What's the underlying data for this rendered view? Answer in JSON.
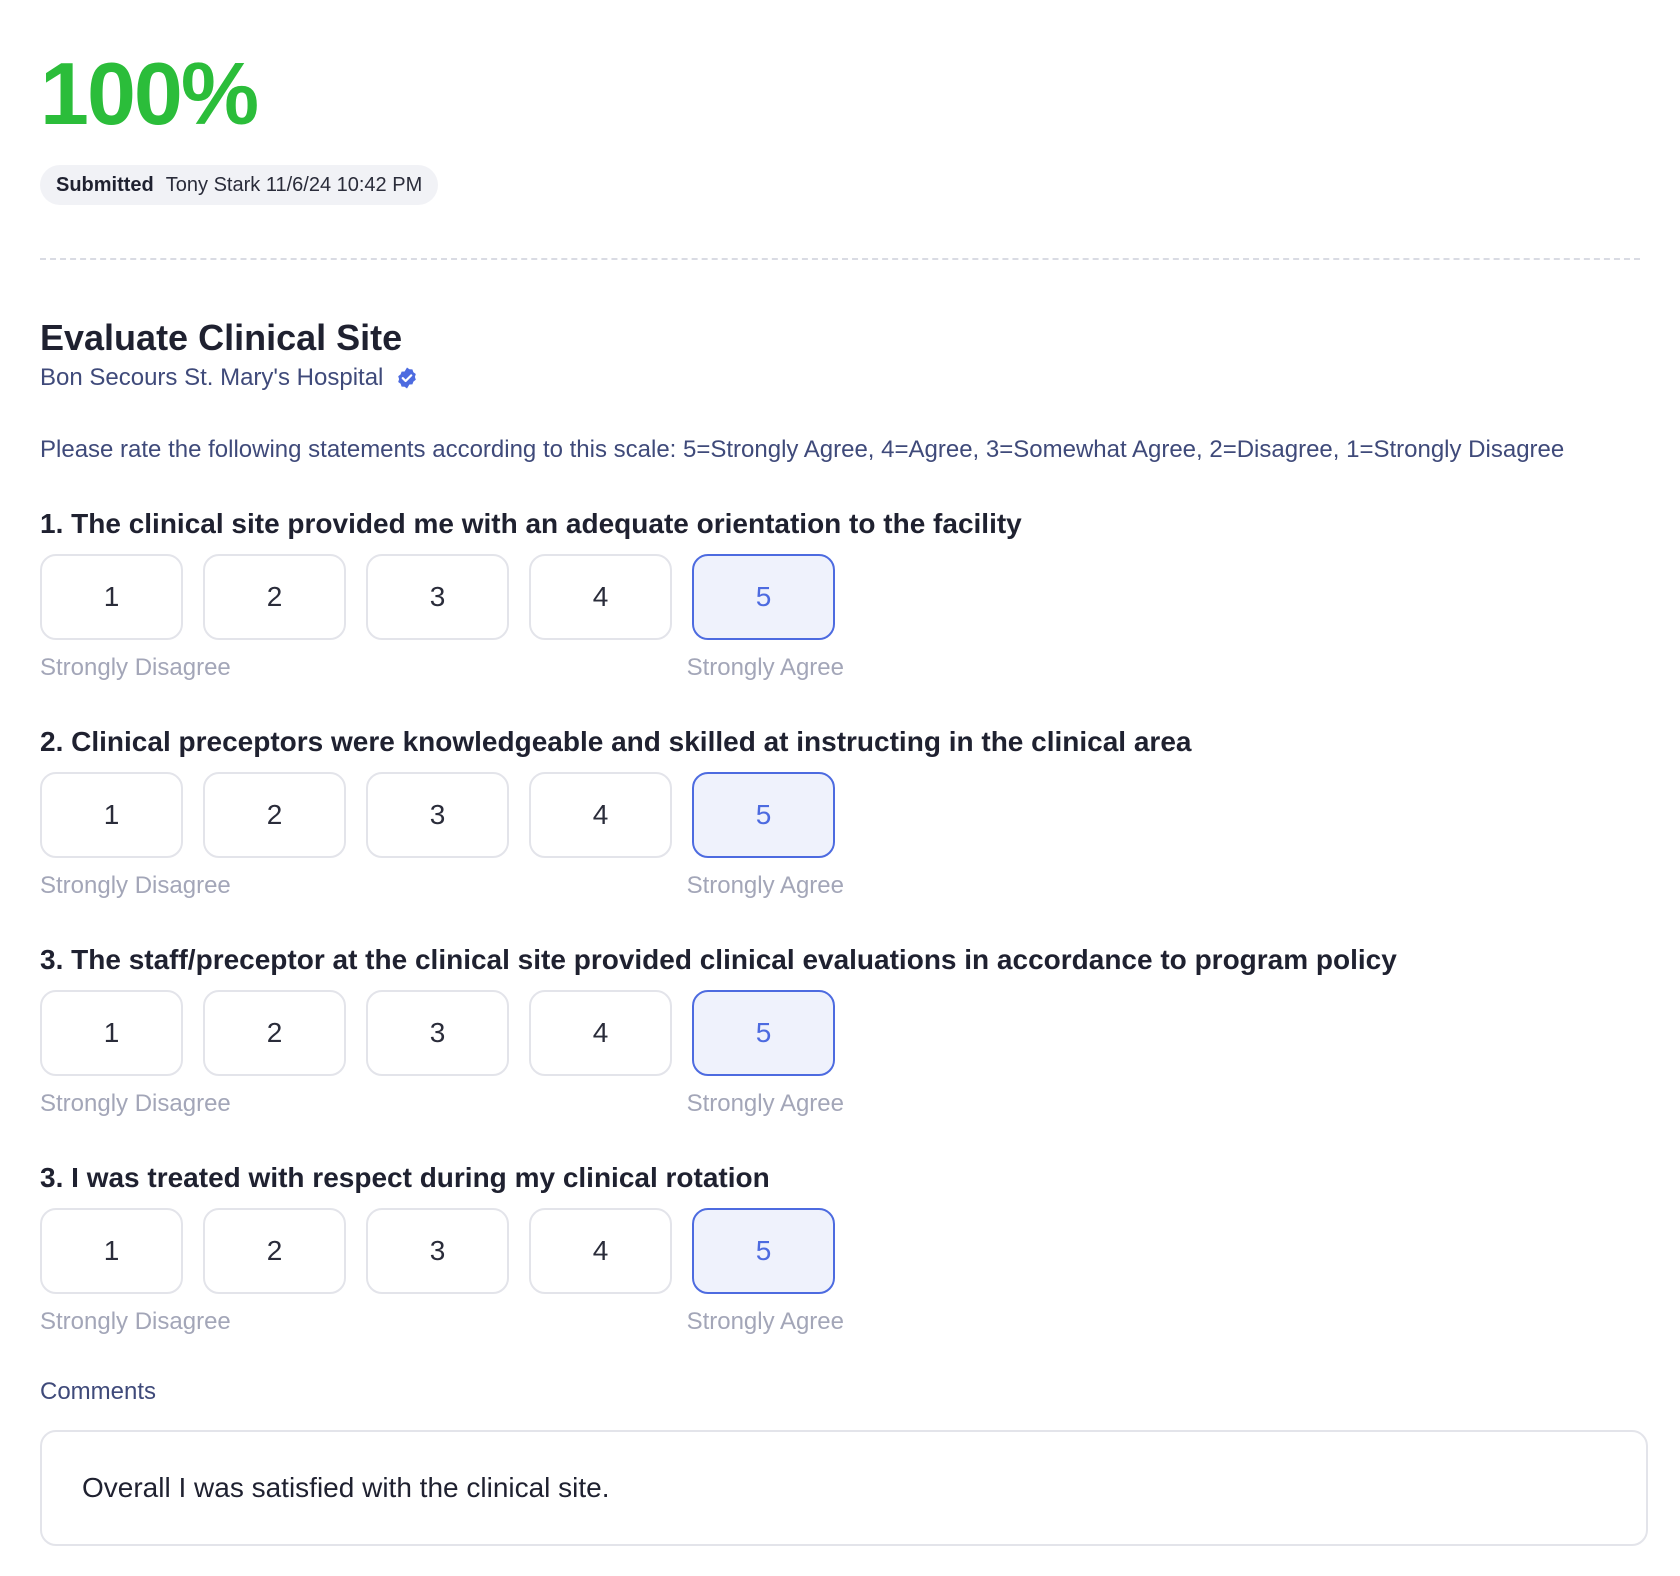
{
  "header": {
    "score": "100%",
    "status": "Submitted",
    "submitted_meta": "Tony Stark 11/6/24 10:42 PM"
  },
  "form": {
    "title": "Evaluate Clinical Site",
    "site_name": "Bon Secours St. Mary's Hospital",
    "instructions": "Please rate the following statements according to this scale: 5=Strongly Agree, 4=Agree, 3=Somewhat Agree, 2=Disagree, 1=Strongly Disagree",
    "scale_options": [
      "1",
      "2",
      "3",
      "4",
      "5"
    ],
    "scale_low_label": "Strongly Disagree",
    "scale_high_label": "Strongly Agree",
    "questions": [
      {
        "text": "1. The clinical site provided me with an adequate orientation to the facility",
        "selected": 5
      },
      {
        "text": "2. Clinical preceptors were knowledgeable and skilled at instructing in the clinical area",
        "selected": 5
      },
      {
        "text": "3. The staff/preceptor at the clinical site provided clinical evaluations in accordance to program policy",
        "selected": 5
      },
      {
        "text": "3. I was treated with respect during my clinical rotation",
        "selected": 5
      }
    ],
    "comments_label": "Comments",
    "comments_value": "Overall I was satisfied with the clinical site."
  },
  "colors": {
    "score_green": "#2bbd3a",
    "accent_blue": "#4d6be0",
    "selected_bg": "#eff2fc"
  },
  "icons": {
    "verified": "verified-badge-icon"
  }
}
